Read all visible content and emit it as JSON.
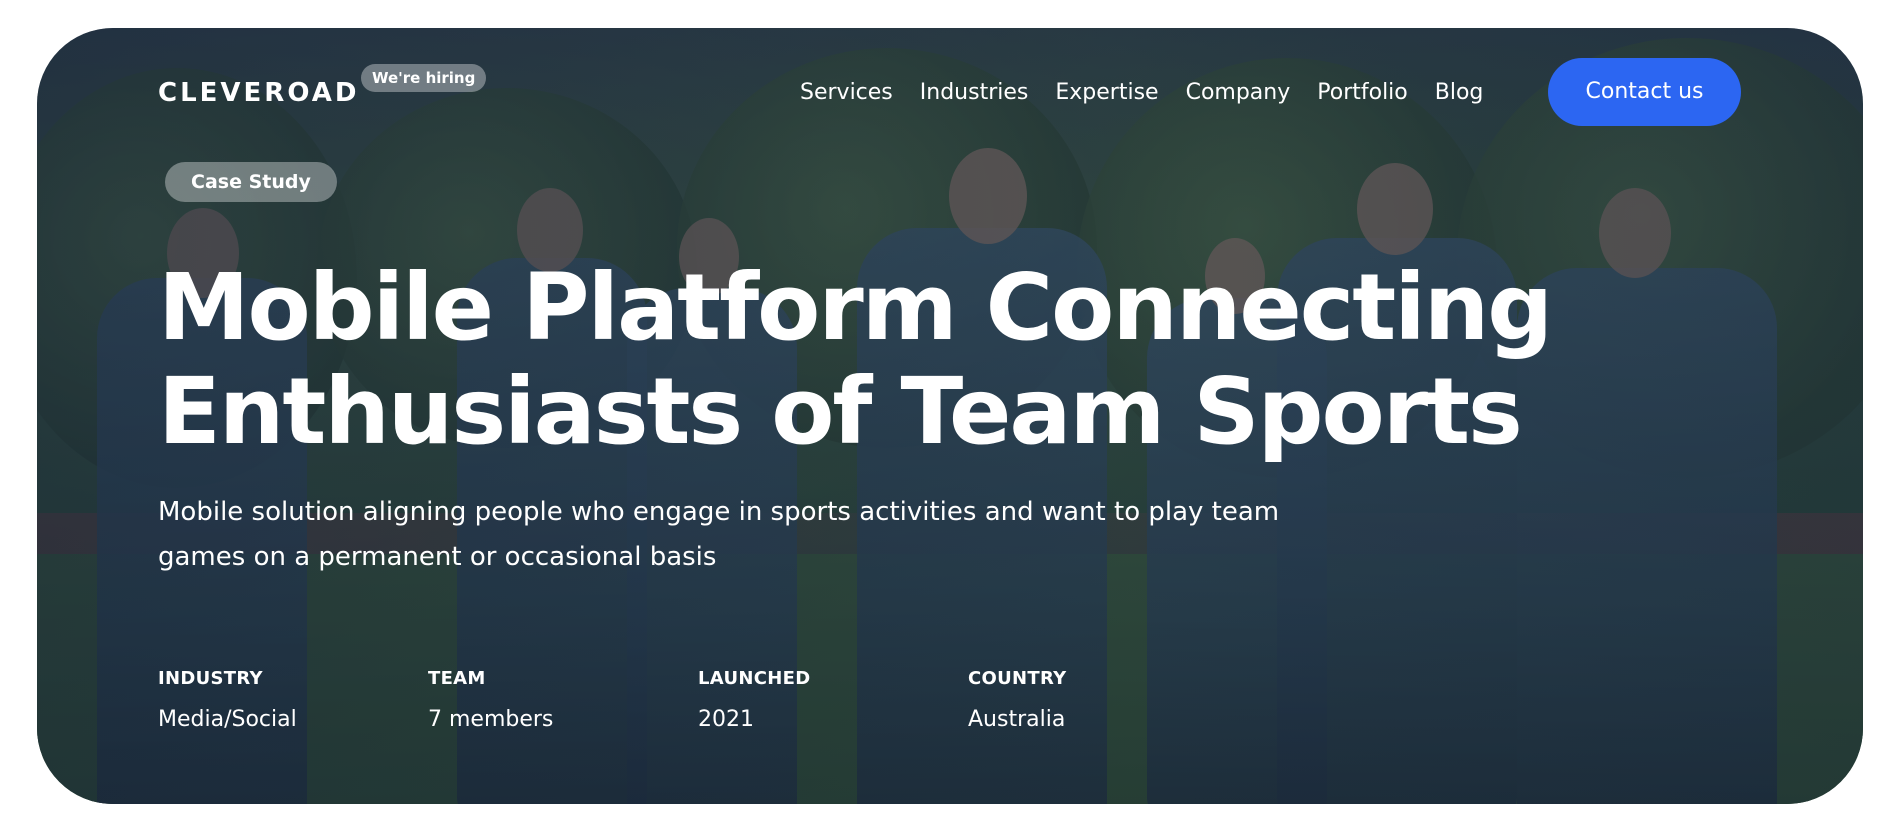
{
  "header": {
    "logo": "CLEVEROAD",
    "hiring_badge": "We're hiring",
    "nav": [
      "Services",
      "Industries",
      "Expertise",
      "Company",
      "Portfolio",
      "Blog"
    ],
    "contact_label": "Contact us"
  },
  "hero": {
    "tag": "Case Study",
    "title": "Mobile Platform Connecting Enthusiasts of Team Sports",
    "subtitle": "Mobile solution aligning people who engage in sports activities and want to play team games on a permanent or occasional basis",
    "facts": [
      {
        "label": "INDUSTRY",
        "value": "Media/Social"
      },
      {
        "label": "TEAM",
        "value": "7 members"
      },
      {
        "label": "LAUNCHED",
        "value": "2021"
      },
      {
        "label": "COUNTRY",
        "value": "Australia"
      }
    ]
  },
  "colors": {
    "accent": "#2c66f2",
    "overlay": "#142037"
  },
  "background_image": "football-team-walking-photo"
}
